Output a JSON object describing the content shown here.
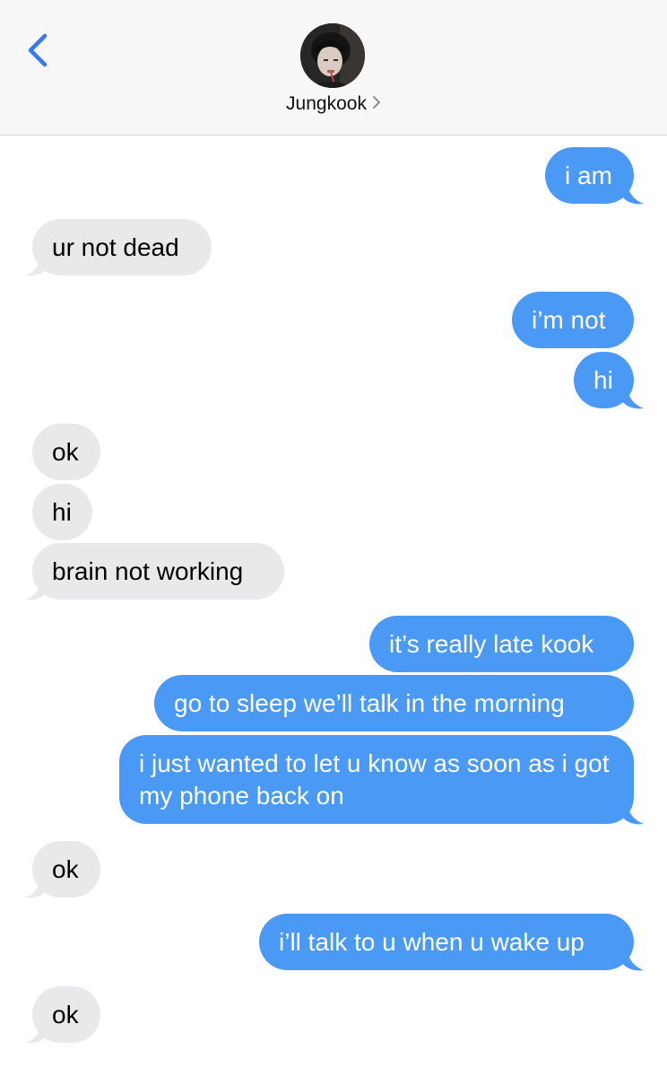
{
  "header": {
    "contact_name": "Jungkook",
    "back_icon": "chevron-left-icon",
    "name_chevron_icon": "chevron-right-icon",
    "accent_color": "#3478f6"
  },
  "colors": {
    "sent_bubble": "#4a9af5",
    "received_bubble": "#e9e9eb"
  },
  "messages": [
    {
      "from": "me",
      "text": "i am"
    },
    {
      "from": "them",
      "text": "ur not dead"
    },
    {
      "from": "me",
      "text": "i’m not"
    },
    {
      "from": "me",
      "text": "hi"
    },
    {
      "from": "them",
      "text": "ok"
    },
    {
      "from": "them",
      "text": "hi"
    },
    {
      "from": "them",
      "text": "brain not working"
    },
    {
      "from": "me",
      "text": "it’s really late kook"
    },
    {
      "from": "me",
      "text": "go to sleep we’ll talk in the morning"
    },
    {
      "from": "me",
      "text": "i just wanted to let u know as soon as i got my phone back on"
    },
    {
      "from": "them",
      "text": "ok"
    },
    {
      "from": "me",
      "text": "i’ll talk to u when u wake up"
    },
    {
      "from": "them",
      "text": "ok"
    }
  ]
}
